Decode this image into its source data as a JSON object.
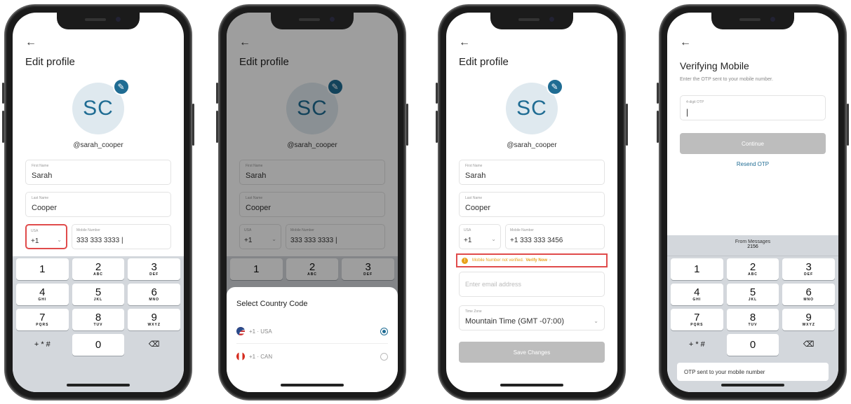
{
  "colors": {
    "accent": "#1f6c93",
    "warning": "#e8a21a",
    "highlight": "#e04b4b",
    "disabled": "#bdbdbd"
  },
  "screens": [
    {
      "back": "←",
      "title": "Edit profile",
      "avatar": "SC",
      "handle": "@sarah_cooper",
      "first_name": {
        "label": "First Name",
        "value": "Sarah"
      },
      "last_name": {
        "label": "Last Name",
        "value": "Cooper"
      },
      "country": {
        "label": "USA",
        "value": "+1",
        "chevron": "⌄"
      },
      "mobile": {
        "label": "Mobile Number",
        "value": "333 333 3333 |"
      }
    },
    {
      "back": "←",
      "title": "Edit profile",
      "avatar": "SC",
      "handle": "@sarah_cooper",
      "first_name": {
        "label": "First Name",
        "value": "Sarah"
      },
      "last_name": {
        "label": "Last Name",
        "value": "Cooper"
      },
      "country": {
        "label": "USA",
        "value": "+1",
        "chevron": "⌄"
      },
      "mobile": {
        "label": "Mobile Number",
        "value": "333 333 3333 |"
      },
      "sheet": {
        "title": "Select Country Code",
        "options": [
          {
            "label": "+1 · USA",
            "selected": true
          },
          {
            "label": "+1 · CAN",
            "selected": false
          }
        ]
      }
    },
    {
      "back": "←",
      "title": "Edit profile",
      "avatar": "SC",
      "handle": "@sarah_cooper",
      "first_name": {
        "label": "First Name",
        "value": "Sarah"
      },
      "last_name": {
        "label": "Last Name",
        "value": "Cooper"
      },
      "country": {
        "label": "USA",
        "value": "+1",
        "chevron": "⌄"
      },
      "mobile": {
        "label": "Mobile Number",
        "value": "+1 333 333 3456"
      },
      "warning": {
        "text": "Mobile Number not verified.",
        "link": "Verify Now",
        "arrow": "›"
      },
      "email": {
        "placeholder": "Enter email address"
      },
      "timezone": {
        "label": "Time Zone",
        "value": "Mountain Time (GMT -07:00)",
        "chevron": "⌄"
      },
      "save": "Save Changes"
    },
    {
      "back": "←",
      "title": "Verifying Mobile",
      "subtitle": "Enter the OTP sent to your mobile number.",
      "otp": {
        "label": "4-digit OTP",
        "value": "|"
      },
      "continue": "Continue",
      "resend": "Resend OTP",
      "suggestion": {
        "source": "From Messages",
        "code": "2156"
      },
      "toast": "OTP sent to your mobile number"
    }
  ],
  "keypad": {
    "rows": [
      [
        {
          "n": "1",
          "l": ""
        },
        {
          "n": "2",
          "l": "ABC"
        },
        {
          "n": "3",
          "l": "DEF"
        }
      ],
      [
        {
          "n": "4",
          "l": "GHI"
        },
        {
          "n": "5",
          "l": "JKL"
        },
        {
          "n": "6",
          "l": "MNO"
        }
      ],
      [
        {
          "n": "7",
          "l": "PQRS"
        },
        {
          "n": "8",
          "l": "TUV"
        },
        {
          "n": "9",
          "l": "WXYZ"
        }
      ]
    ],
    "symbols": "+ * #",
    "zero": "0",
    "delete": "⌫"
  }
}
